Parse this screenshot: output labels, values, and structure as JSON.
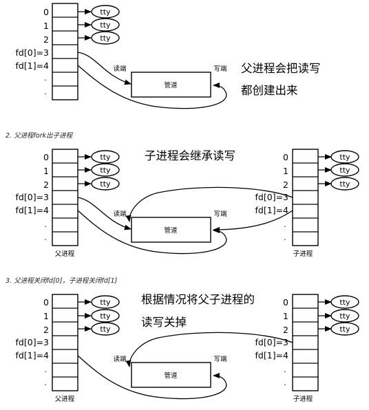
{
  "labels": {
    "fd0": "0",
    "fd1": "1",
    "fd2": "2",
    "fd_read": "fd[0]=3",
    "fd_write": "fd[1]=4",
    "dot": ".",
    "tty": "tty",
    "pipe": "管道",
    "read_end": "读端",
    "write_end": "写端",
    "parent": "父进程",
    "child": "子进程"
  },
  "steps": [
    {
      "caption": "",
      "note_lines": [
        "父进程会把读写",
        "都创建出来"
      ]
    },
    {
      "caption": "2. 父进程fork出子进程",
      "note_lines": [
        "子进程会继承读写"
      ]
    },
    {
      "caption": "3. 父进程关闭fd[0]，子进程关闭fd[1]",
      "note_lines": [
        "根据情况将父子进程的",
        "读写关掉"
      ]
    }
  ]
}
